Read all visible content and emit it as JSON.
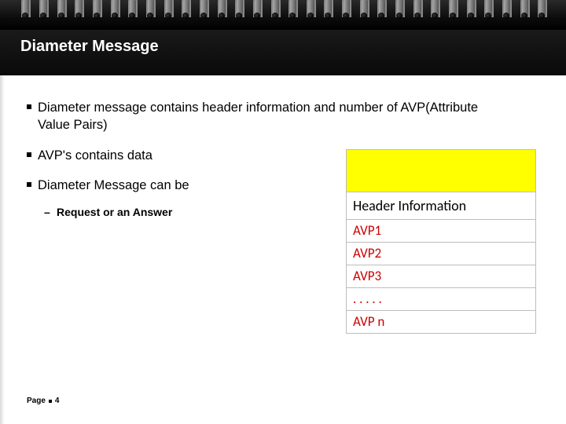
{
  "title": "Diameter Message",
  "bullets": {
    "b1": "Diameter message contains header information and number of AVP(Attribute Value Pairs)",
    "b2": "AVP's contains data",
    "b3": "Diameter Message can be",
    "sub1": "Request or an Answer"
  },
  "diagram": {
    "header": "Header Information",
    "rows": {
      "r1": "AVP1",
      "r2": "AVP2",
      "r3": "AVP3",
      "r4": ". . . . .",
      "r5": "AVP n"
    }
  },
  "footer": {
    "page_label": "Page",
    "page_num": "4"
  }
}
